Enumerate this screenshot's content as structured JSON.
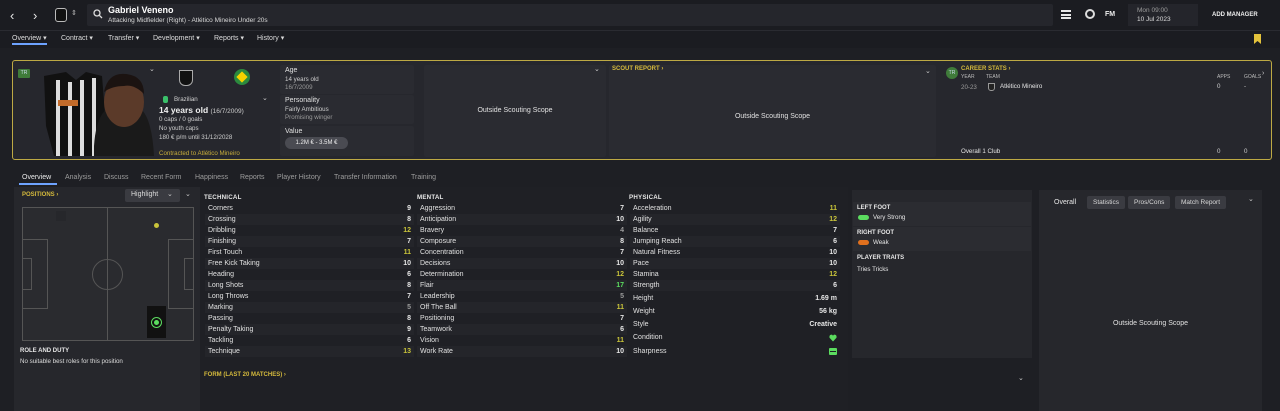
{
  "header": {
    "player_name": "Gabriel Veneno",
    "subtitle": "Attacking Midfielder (Right) - Atlético Mineiro Under 20s",
    "day_time": "Mon 09:00",
    "date": "10 Jul 2023",
    "add_manager_label": "ADD MANAGER",
    "fm_label": "FM"
  },
  "nav": {
    "items": [
      "Overview",
      "Contract",
      "Transfer",
      "Development",
      "Reports",
      "History"
    ],
    "active_index": 0
  },
  "summary": {
    "badge": "TR",
    "nationality": "Brazilian",
    "age_line": "14 years old",
    "dob_short": "(16/7/2009)",
    "caps_goals": "0 caps / 0 goals",
    "youth_caps": "No youth caps",
    "wage": "180 € p/m until 31/12/2028",
    "contract": "Contracted to Atlético Mineiro",
    "age_label": "Age",
    "age_value": "14 years old",
    "dob": "16/7/2009",
    "personality_label": "Personality",
    "personality_value": "Fairly Ambitious",
    "media_desc": "Promising winger",
    "value_label": "Value",
    "value_range": "1.2M € - 3.5M €",
    "scope_text_1": "Outside Scouting Scope",
    "scout_report_label": "SCOUT REPORT",
    "scope_text_2": "Outside Scouting Scope"
  },
  "career": {
    "title": "CAREER STATS",
    "badge": "TR",
    "year_label": "YEAR",
    "team_label": "TEAM",
    "apps_label": "APPS",
    "goals_label": "GOALS",
    "year": "20-23",
    "team": "Atlético Mineiro",
    "apps": "0",
    "goals": "-",
    "overall_label": "Overall 1 Club",
    "overall_apps": "0",
    "overall_goals": "0"
  },
  "tabs": {
    "items": [
      "Overview",
      "Analysis",
      "Discuss",
      "Recent Form",
      "Happiness",
      "Reports",
      "Player History",
      "Transfer Information",
      "Training"
    ],
    "active_index": 0
  },
  "positions": {
    "title": "POSITIONS",
    "highlight_label": "Highlight",
    "role_title": "ROLE AND DUTY",
    "role_text": "No suitable best roles for this position"
  },
  "attributes": {
    "technical_title": "TECHNICAL",
    "mental_title": "MENTAL",
    "physical_title": "PHYSICAL",
    "technical": [
      {
        "name": "Corners",
        "value": "9",
        "tone": "w"
      },
      {
        "name": "Crossing",
        "value": "8",
        "tone": "w"
      },
      {
        "name": "Dribbling",
        "value": "12",
        "tone": "y"
      },
      {
        "name": "Finishing",
        "value": "7",
        "tone": "w"
      },
      {
        "name": "First Touch",
        "value": "11",
        "tone": "y"
      },
      {
        "name": "Free Kick Taking",
        "value": "10",
        "tone": "w"
      },
      {
        "name": "Heading",
        "value": "6",
        "tone": "w"
      },
      {
        "name": "Long Shots",
        "value": "8",
        "tone": "w"
      },
      {
        "name": "Long Throws",
        "value": "7",
        "tone": "w"
      },
      {
        "name": "Marking",
        "value": "5",
        "tone": "d"
      },
      {
        "name": "Passing",
        "value": "8",
        "tone": "w"
      },
      {
        "name": "Penalty Taking",
        "value": "9",
        "tone": "w"
      },
      {
        "name": "Tackling",
        "value": "6",
        "tone": "w"
      },
      {
        "name": "Technique",
        "value": "13",
        "tone": "y"
      }
    ],
    "mental": [
      {
        "name": "Aggression",
        "value": "7",
        "tone": "w"
      },
      {
        "name": "Anticipation",
        "value": "10",
        "tone": "w"
      },
      {
        "name": "Bravery",
        "value": "4",
        "tone": "d"
      },
      {
        "name": "Composure",
        "value": "8",
        "tone": "w"
      },
      {
        "name": "Concentration",
        "value": "7",
        "tone": "w"
      },
      {
        "name": "Decisions",
        "value": "10",
        "tone": "w"
      },
      {
        "name": "Determination",
        "value": "12",
        "tone": "y"
      },
      {
        "name": "Flair",
        "value": "17",
        "tone": "g"
      },
      {
        "name": "Leadership",
        "value": "5",
        "tone": "d"
      },
      {
        "name": "Off The Ball",
        "value": "11",
        "tone": "y"
      },
      {
        "name": "Positioning",
        "value": "7",
        "tone": "w"
      },
      {
        "name": "Teamwork",
        "value": "6",
        "tone": "w"
      },
      {
        "name": "Vision",
        "value": "11",
        "tone": "y"
      },
      {
        "name": "Work Rate",
        "value": "10",
        "tone": "w"
      }
    ],
    "physical": [
      {
        "name": "Acceleration",
        "value": "11",
        "tone": "y"
      },
      {
        "name": "Agility",
        "value": "12",
        "tone": "y"
      },
      {
        "name": "Balance",
        "value": "7",
        "tone": "w"
      },
      {
        "name": "Jumping Reach",
        "value": "6",
        "tone": "w"
      },
      {
        "name": "Natural Fitness",
        "value": "10",
        "tone": "w"
      },
      {
        "name": "Pace",
        "value": "10",
        "tone": "w"
      },
      {
        "name": "Stamina",
        "value": "12",
        "tone": "y"
      },
      {
        "name": "Strength",
        "value": "6",
        "tone": "w"
      }
    ],
    "height_label": "Height",
    "height": "1.69 m",
    "weight_label": "Weight",
    "weight": "56 kg",
    "style_label": "Style",
    "style": "Creative",
    "condition_label": "Condition",
    "sharpness_label": "Sharpness",
    "form_title": "FORM (LAST 20 MATCHES)"
  },
  "feet": {
    "left_title": "LEFT FOOT",
    "left_value": "Very Strong",
    "right_title": "RIGHT FOOT",
    "right_value": "Weak",
    "traits_title": "PLAYER TRAITS",
    "trait": "Tries Tricks"
  },
  "right_panel": {
    "tabs": [
      "Overall",
      "Statistics",
      "Pros/Cons",
      "Match Report"
    ],
    "scope_text": "Outside Scouting Scope"
  },
  "colors": {
    "gold": "#d4b93c",
    "green": "#5bdc5f",
    "yellow": "#c9c43a",
    "accent_blue": "#6ea3ff"
  }
}
